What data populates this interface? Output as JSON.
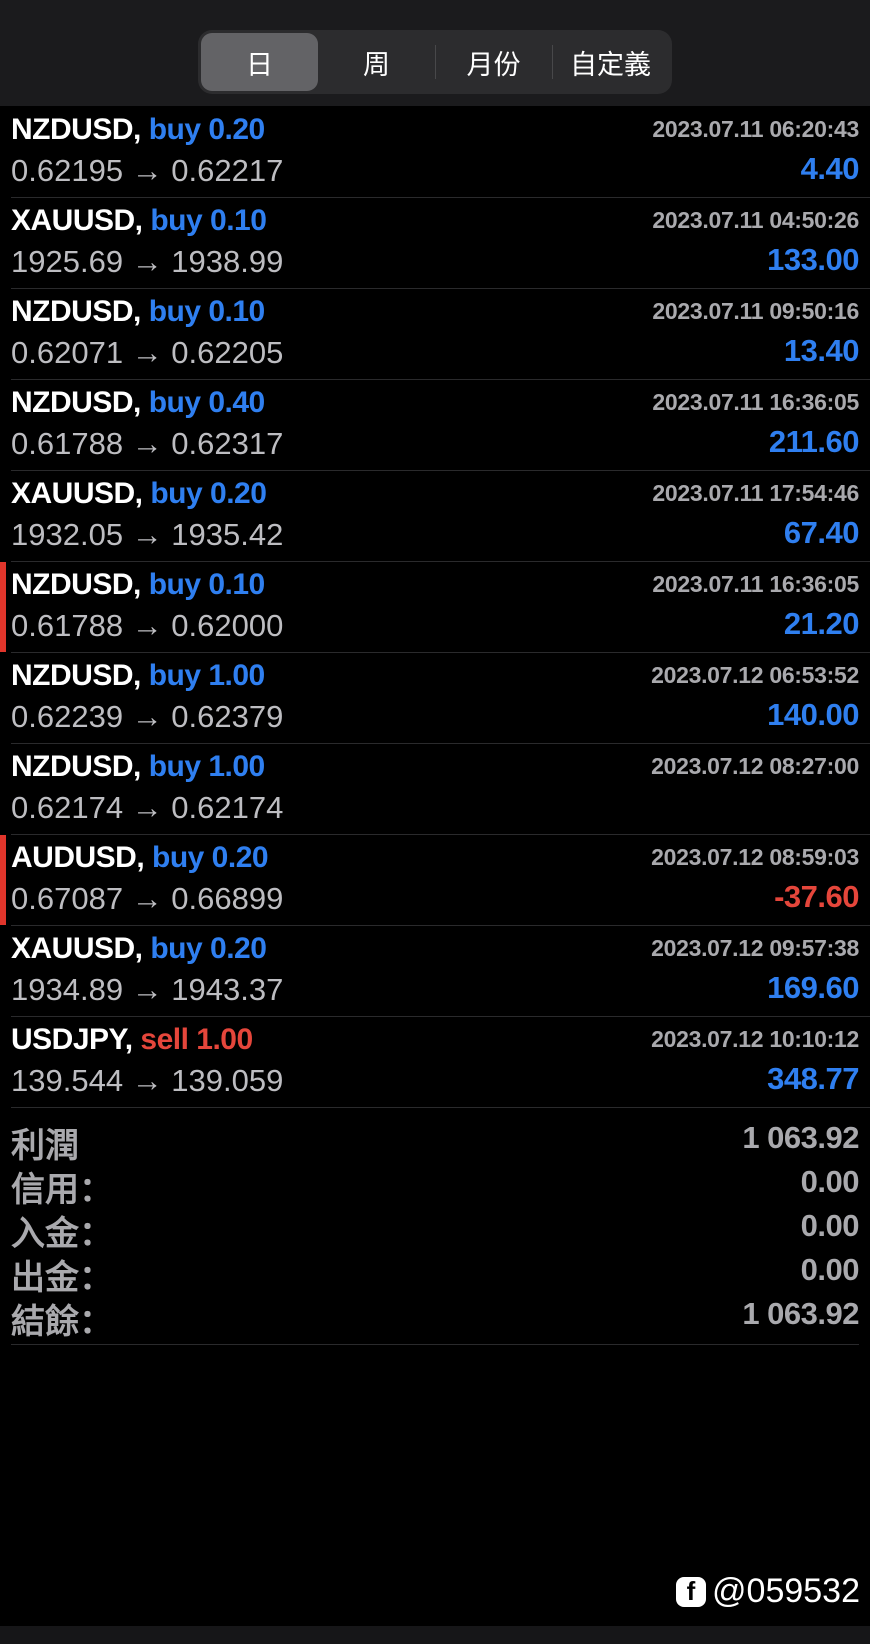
{
  "tabs": [
    "日",
    "周",
    "月份",
    "自定義"
  ],
  "trades": [
    {
      "symbol": "NZDUSD,",
      "side": "buy 0.20",
      "time": "2023.07.11 06:20:43",
      "prices": "0.62195 → 0.62217",
      "profit": "4.40"
    },
    {
      "symbol": "XAUUSD,",
      "side": "buy 0.10",
      "time": "2023.07.11 04:50:26",
      "prices": "1925.69 → 1938.99",
      "profit": "133.00"
    },
    {
      "symbol": "NZDUSD,",
      "side": "buy 0.10",
      "time": "2023.07.11 09:50:16",
      "prices": "0.62071 → 0.62205",
      "profit": "13.40"
    },
    {
      "symbol": "NZDUSD,",
      "side": "buy 0.40",
      "time": "2023.07.11 16:36:05",
      "prices": "0.61788 → 0.62317",
      "profit": "211.60"
    },
    {
      "symbol": "XAUUSD,",
      "side": "buy 0.20",
      "time": "2023.07.11 17:54:46",
      "prices": "1932.05 → 1935.42",
      "profit": "67.40"
    },
    {
      "symbol": "NZDUSD,",
      "side": "buy 0.10",
      "time": "2023.07.11 16:36:05",
      "prices": "0.61788 → 0.62000",
      "profit": "21.20"
    },
    {
      "symbol": "NZDUSD,",
      "side": "buy 1.00",
      "time": "2023.07.12 06:53:52",
      "prices": "0.62239 → 0.62379",
      "profit": "140.00"
    },
    {
      "symbol": "NZDUSD,",
      "side": "buy 1.00",
      "time": "2023.07.12 08:27:00",
      "prices": "0.62174 → 0.62174",
      "profit": ""
    },
    {
      "symbol": "AUDUSD,",
      "side": "buy 0.20",
      "time": "2023.07.12 08:59:03",
      "prices": "0.67087 → 0.66899",
      "profit": "-37.60"
    },
    {
      "symbol": "XAUUSD,",
      "side": "buy 0.20",
      "time": "2023.07.12 09:57:38",
      "prices": "1934.89 → 1943.37",
      "profit": "169.60"
    },
    {
      "symbol": "USDJPY,",
      "side": "sell 1.00",
      "time": "2023.07.12 10:10:12",
      "prices": "139.544 → 139.059",
      "profit": "348.77"
    }
  ],
  "summary": [
    {
      "label": "利潤",
      "value": "1 063.92"
    },
    {
      "label": "信用：",
      "value": "0.00"
    },
    {
      "label": "入金：",
      "value": "0.00"
    },
    {
      "label": "出金：",
      "value": "0.00"
    },
    {
      "label": "結餘：",
      "value": "1 063.92"
    }
  ],
  "watermark": {
    "icon": "f",
    "handle": "@059532"
  },
  "colors": {
    "buy": "#2f7ff0",
    "sell": "#e5463b",
    "marker": "#e0352b"
  }
}
